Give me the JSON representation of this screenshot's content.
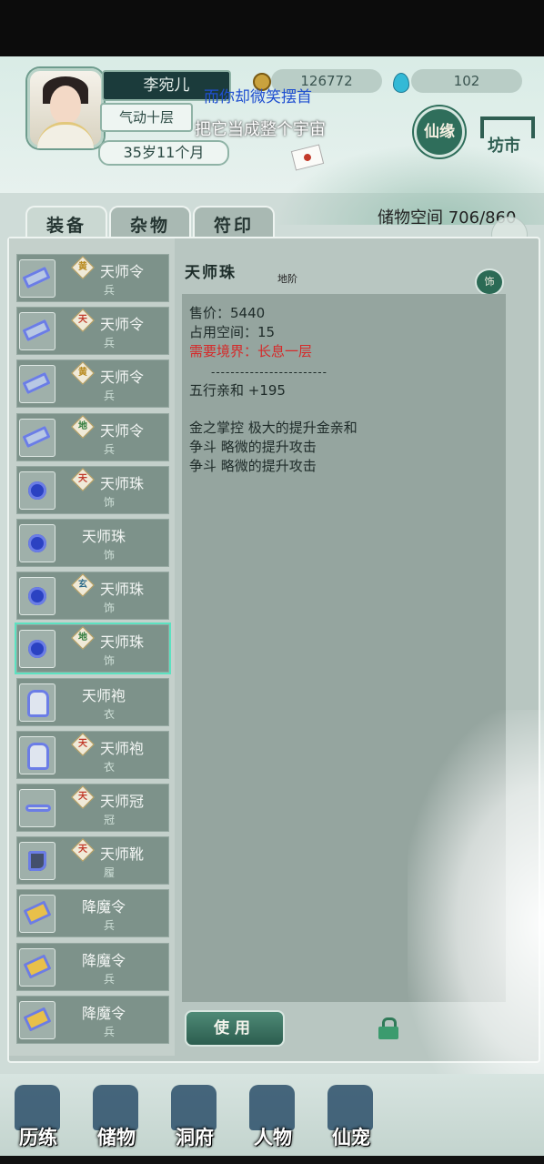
{
  "player": {
    "name": "李宛儿",
    "realm": "气动十层",
    "age": "35岁11个月"
  },
  "currency": {
    "money": "126772",
    "gems": "102"
  },
  "subtitle": {
    "line1": "而你却微笑摆首",
    "line2": "把它当成整个宇宙"
  },
  "header_buttons": {
    "xianyuan": "仙缘",
    "fangshi": "坊市"
  },
  "tabs": [
    "装备",
    "杂物",
    "符印"
  ],
  "storage": {
    "label": "储物空间",
    "value": "706/860"
  },
  "items": [
    {
      "name": "天师令",
      "type": "兵",
      "tier": "黄",
      "icon": "flag"
    },
    {
      "name": "天师令",
      "type": "兵",
      "tier": "天",
      "icon": "flag"
    },
    {
      "name": "天师令",
      "type": "兵",
      "tier": "黄",
      "icon": "flag"
    },
    {
      "name": "天师令",
      "type": "兵",
      "tier": "地",
      "icon": "flag"
    },
    {
      "name": "天师珠",
      "type": "饰",
      "tier": "天",
      "icon": "orb"
    },
    {
      "name": "天师珠",
      "type": "饰",
      "tier": "",
      "icon": "orb"
    },
    {
      "name": "天师珠",
      "type": "饰",
      "tier": "玄",
      "icon": "orb"
    },
    {
      "name": "天师珠",
      "type": "饰",
      "tier": "地",
      "icon": "orb",
      "selected": true
    },
    {
      "name": "天师袍",
      "type": "衣",
      "tier": "",
      "icon": "robe"
    },
    {
      "name": "天师袍",
      "type": "衣",
      "tier": "天",
      "icon": "robe"
    },
    {
      "name": "天师冠",
      "type": "冠",
      "tier": "天",
      "icon": "hat"
    },
    {
      "name": "天师靴",
      "type": "履",
      "tier": "天",
      "icon": "boot"
    },
    {
      "name": "降魔令",
      "type": "兵",
      "tier": "",
      "icon": "gold"
    },
    {
      "name": "降魔令",
      "type": "兵",
      "tier": "",
      "icon": "gold"
    },
    {
      "name": "降魔令",
      "type": "兵",
      "tier": "",
      "icon": "gold"
    }
  ],
  "detail": {
    "title": "天师珠",
    "tier": "地阶",
    "slot": "饰",
    "price": "售价：5440",
    "space": "占用空间：15",
    "requirement": "需要境界：长息一层",
    "separator": "------------------------",
    "stat": "五行亲和 +195",
    "effects": [
      "金之掌控 极大的提升金亲和",
      "争斗 略微的提升攻击",
      "争斗 略微的提升攻击"
    ],
    "use_label": "使用"
  },
  "bottom_nav": [
    "历练",
    "储物",
    "洞府",
    "人物",
    "仙宠"
  ],
  "colors": {
    "panel": "#b8c6c1",
    "item": "#7d928a",
    "selected_glow": "#5ce2c1",
    "requirement": "#d52a2a"
  }
}
